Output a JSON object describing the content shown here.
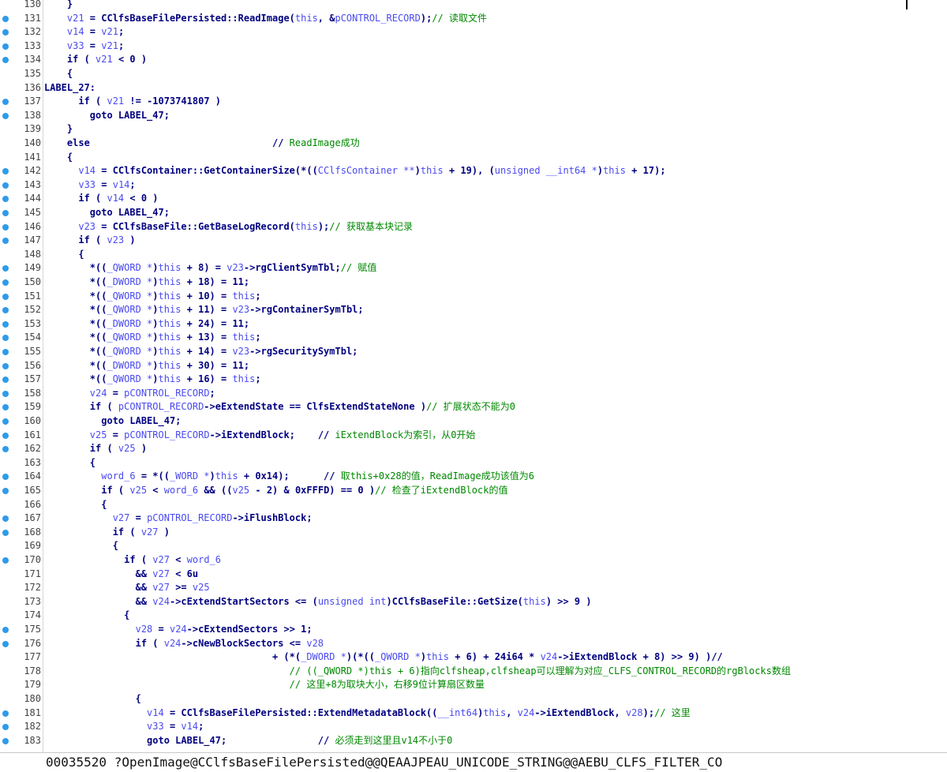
{
  "editor": {
    "lines": [
      {
        "n": "130",
        "bp": false,
        "s": [
          [
            "n",
            "    }"
          ]
        ]
      },
      {
        "n": "131",
        "bp": true,
        "s": [
          [
            "v",
            "    v21"
          ],
          [
            "n",
            " = CClfsBaseFilePersisted::ReadImage("
          ],
          [
            "v",
            "this"
          ],
          [
            "n",
            ", &"
          ],
          [
            "v",
            "pCONTROL_RECORD"
          ],
          [
            "n",
            ");"
          ],
          [
            "c",
            "// 读取文件"
          ]
        ]
      },
      {
        "n": "132",
        "bp": true,
        "s": [
          [
            "v",
            "    v14"
          ],
          [
            "n",
            " = "
          ],
          [
            "v",
            "v21"
          ],
          [
            "n",
            ";"
          ]
        ]
      },
      {
        "n": "133",
        "bp": true,
        "s": [
          [
            "v",
            "    v33"
          ],
          [
            "n",
            " = "
          ],
          [
            "v",
            "v21"
          ],
          [
            "n",
            ";"
          ]
        ]
      },
      {
        "n": "134",
        "bp": true,
        "s": [
          [
            "n",
            "    if ( "
          ],
          [
            "v",
            "v21"
          ],
          [
            "n",
            " < 0 )"
          ]
        ]
      },
      {
        "n": "135",
        "bp": false,
        "s": [
          [
            "n",
            "    {"
          ]
        ]
      },
      {
        "n": "136",
        "bp": false,
        "s": [
          [
            "n",
            "LABEL_27:"
          ]
        ]
      },
      {
        "n": "137",
        "bp": true,
        "s": [
          [
            "n",
            "      if ( "
          ],
          [
            "v",
            "v21"
          ],
          [
            "n",
            " != -1073741807 )"
          ]
        ]
      },
      {
        "n": "138",
        "bp": true,
        "s": [
          [
            "n",
            "        goto LABEL_47;"
          ]
        ]
      },
      {
        "n": "139",
        "bp": false,
        "s": [
          [
            "n",
            "    }"
          ]
        ]
      },
      {
        "n": "140",
        "bp": false,
        "s": [
          [
            "n",
            "    else                                // "
          ],
          [
            "c",
            "ReadImage成功"
          ]
        ]
      },
      {
        "n": "141",
        "bp": false,
        "s": [
          [
            "n",
            "    {"
          ]
        ]
      },
      {
        "n": "142",
        "bp": true,
        "s": [
          [
            "v",
            "      v14"
          ],
          [
            "n",
            " = CClfsContainer::GetContainerSize(*(("
          ],
          [
            "v",
            "CClfsContainer **"
          ],
          [
            "n",
            ")"
          ],
          [
            "v",
            "this"
          ],
          [
            "n",
            " + 19), ("
          ],
          [
            "v",
            "unsigned __int64 *"
          ],
          [
            "n",
            ")"
          ],
          [
            "v",
            "this"
          ],
          [
            "n",
            " + 17);"
          ]
        ]
      },
      {
        "n": "143",
        "bp": true,
        "s": [
          [
            "v",
            "      v33"
          ],
          [
            "n",
            " = "
          ],
          [
            "v",
            "v14"
          ],
          [
            "n",
            ";"
          ]
        ]
      },
      {
        "n": "144",
        "bp": true,
        "s": [
          [
            "n",
            "      if ( "
          ],
          [
            "v",
            "v14"
          ],
          [
            "n",
            " < 0 )"
          ]
        ]
      },
      {
        "n": "145",
        "bp": true,
        "s": [
          [
            "n",
            "        goto LABEL_47;"
          ]
        ]
      },
      {
        "n": "146",
        "bp": true,
        "s": [
          [
            "v",
            "      v23"
          ],
          [
            "n",
            " = CClfsBaseFile::GetBaseLogRecord("
          ],
          [
            "v",
            "this"
          ],
          [
            "n",
            ");"
          ],
          [
            "c",
            "// 获取基本块记录"
          ]
        ]
      },
      {
        "n": "147",
        "bp": true,
        "s": [
          [
            "n",
            "      if ( "
          ],
          [
            "v",
            "v23"
          ],
          [
            "n",
            " )"
          ]
        ]
      },
      {
        "n": "148",
        "bp": false,
        "s": [
          [
            "n",
            "      {"
          ]
        ]
      },
      {
        "n": "149",
        "bp": true,
        "s": [
          [
            "n",
            "        *(("
          ],
          [
            "v",
            "_QWORD *"
          ],
          [
            "n",
            ")"
          ],
          [
            "v",
            "this"
          ],
          [
            "n",
            " + 8) = "
          ],
          [
            "v",
            "v23"
          ],
          [
            "n",
            "->rgClientSymTbl;"
          ],
          [
            "c",
            "// 赋值"
          ]
        ]
      },
      {
        "n": "150",
        "bp": true,
        "s": [
          [
            "n",
            "        *(("
          ],
          [
            "v",
            "_DWORD *"
          ],
          [
            "n",
            ")"
          ],
          [
            "v",
            "this"
          ],
          [
            "n",
            " + 18) = 11;"
          ]
        ]
      },
      {
        "n": "151",
        "bp": true,
        "s": [
          [
            "n",
            "        *(("
          ],
          [
            "v",
            "_QWORD *"
          ],
          [
            "n",
            ")"
          ],
          [
            "v",
            "this"
          ],
          [
            "n",
            " + 10) = "
          ],
          [
            "v",
            "this"
          ],
          [
            "n",
            ";"
          ]
        ]
      },
      {
        "n": "152",
        "bp": true,
        "s": [
          [
            "n",
            "        *(("
          ],
          [
            "v",
            "_QWORD *"
          ],
          [
            "n",
            ")"
          ],
          [
            "v",
            "this"
          ],
          [
            "n",
            " + 11) = "
          ],
          [
            "v",
            "v23"
          ],
          [
            "n",
            "->rgContainerSymTbl;"
          ]
        ]
      },
      {
        "n": "153",
        "bp": true,
        "s": [
          [
            "n",
            "        *(("
          ],
          [
            "v",
            "_DWORD *"
          ],
          [
            "n",
            ")"
          ],
          [
            "v",
            "this"
          ],
          [
            "n",
            " + 24) = 11;"
          ]
        ]
      },
      {
        "n": "154",
        "bp": true,
        "s": [
          [
            "n",
            "        *(("
          ],
          [
            "v",
            "_QWORD *"
          ],
          [
            "n",
            ")"
          ],
          [
            "v",
            "this"
          ],
          [
            "n",
            " + 13) = "
          ],
          [
            "v",
            "this"
          ],
          [
            "n",
            ";"
          ]
        ]
      },
      {
        "n": "155",
        "bp": true,
        "s": [
          [
            "n",
            "        *(("
          ],
          [
            "v",
            "_QWORD *"
          ],
          [
            "n",
            ")"
          ],
          [
            "v",
            "this"
          ],
          [
            "n",
            " + 14) = "
          ],
          [
            "v",
            "v23"
          ],
          [
            "n",
            "->rgSecuritySymTbl;"
          ]
        ]
      },
      {
        "n": "156",
        "bp": true,
        "s": [
          [
            "n",
            "        *(("
          ],
          [
            "v",
            "_DWORD *"
          ],
          [
            "n",
            ")"
          ],
          [
            "v",
            "this"
          ],
          [
            "n",
            " + 30) = 11;"
          ]
        ]
      },
      {
        "n": "157",
        "bp": true,
        "s": [
          [
            "n",
            "        *(("
          ],
          [
            "v",
            "_QWORD *"
          ],
          [
            "n",
            ")"
          ],
          [
            "v",
            "this"
          ],
          [
            "n",
            " + 16) = "
          ],
          [
            "v",
            "this"
          ],
          [
            "n",
            ";"
          ]
        ]
      },
      {
        "n": "158",
        "bp": true,
        "s": [
          [
            "v",
            "        v24"
          ],
          [
            "n",
            " = "
          ],
          [
            "v",
            "pCONTROL_RECORD"
          ],
          [
            "n",
            ";"
          ]
        ]
      },
      {
        "n": "159",
        "bp": true,
        "s": [
          [
            "n",
            "        if ( "
          ],
          [
            "v",
            "pCONTROL_RECORD"
          ],
          [
            "n",
            "->eExtendState == ClfsExtendStateNone )"
          ],
          [
            "c",
            "// 扩展状态不能为0"
          ]
        ]
      },
      {
        "n": "160",
        "bp": true,
        "s": [
          [
            "n",
            "          goto LABEL_47;"
          ]
        ]
      },
      {
        "n": "161",
        "bp": true,
        "s": [
          [
            "v",
            "        v25"
          ],
          [
            "n",
            " = "
          ],
          [
            "v",
            "pCONTROL_RECORD"
          ],
          [
            "n",
            "->iExtendBlock;    // "
          ],
          [
            "c",
            "iExtendBlock为索引，从0开始"
          ]
        ]
      },
      {
        "n": "162",
        "bp": true,
        "s": [
          [
            "n",
            "        if ( "
          ],
          [
            "v",
            "v25"
          ],
          [
            "n",
            " )"
          ]
        ]
      },
      {
        "n": "163",
        "bp": false,
        "s": [
          [
            "n",
            "        {"
          ]
        ]
      },
      {
        "n": "164",
        "bp": true,
        "s": [
          [
            "v",
            "          word_6"
          ],
          [
            "n",
            " = *(("
          ],
          [
            "v",
            "_WORD *"
          ],
          [
            "n",
            ")"
          ],
          [
            "v",
            "this"
          ],
          [
            "n",
            " + 0x14);      // "
          ],
          [
            "c",
            "取this+0x28的值，ReadImage成功该值为6"
          ]
        ]
      },
      {
        "n": "165",
        "bp": true,
        "s": [
          [
            "n",
            "          if ( "
          ],
          [
            "v",
            "v25"
          ],
          [
            "n",
            " < "
          ],
          [
            "v",
            "word_6"
          ],
          [
            "n",
            " && (("
          ],
          [
            "v",
            "v25"
          ],
          [
            "n",
            " - 2) & 0xFFFD) == 0 )"
          ],
          [
            "c",
            "// 检查了iExtendBlock的值"
          ]
        ]
      },
      {
        "n": "166",
        "bp": false,
        "s": [
          [
            "n",
            "          {"
          ]
        ]
      },
      {
        "n": "167",
        "bp": true,
        "s": [
          [
            "v",
            "            v27"
          ],
          [
            "n",
            " = "
          ],
          [
            "v",
            "pCONTROL_RECORD"
          ],
          [
            "n",
            "->iFlushBlock;"
          ]
        ]
      },
      {
        "n": "168",
        "bp": true,
        "s": [
          [
            "n",
            "            if ( "
          ],
          [
            "v",
            "v27"
          ],
          [
            "n",
            " )"
          ]
        ]
      },
      {
        "n": "169",
        "bp": false,
        "s": [
          [
            "n",
            "            {"
          ]
        ]
      },
      {
        "n": "170",
        "bp": true,
        "s": [
          [
            "n",
            "              if ( "
          ],
          [
            "v",
            "v27"
          ],
          [
            "n",
            " < "
          ],
          [
            "v",
            "word_6"
          ]
        ]
      },
      {
        "n": "171",
        "bp": false,
        "s": [
          [
            "n",
            "                && "
          ],
          [
            "v",
            "v27"
          ],
          [
            "n",
            " < 6u"
          ]
        ]
      },
      {
        "n": "172",
        "bp": false,
        "s": [
          [
            "n",
            "                && "
          ],
          [
            "v",
            "v27"
          ],
          [
            "n",
            " >= "
          ],
          [
            "v",
            "v25"
          ]
        ]
      },
      {
        "n": "173",
        "bp": false,
        "s": [
          [
            "n",
            "                && "
          ],
          [
            "v",
            "v24"
          ],
          [
            "n",
            "->cExtendStartSectors <= ("
          ],
          [
            "v",
            "unsigned int"
          ],
          [
            "n",
            ")CClfsBaseFile::GetSize("
          ],
          [
            "v",
            "this"
          ],
          [
            "n",
            ") >> 9 )"
          ]
        ]
      },
      {
        "n": "174",
        "bp": false,
        "s": [
          [
            "n",
            "              {"
          ]
        ]
      },
      {
        "n": "175",
        "bp": true,
        "s": [
          [
            "v",
            "                v28"
          ],
          [
            "n",
            " = "
          ],
          [
            "v",
            "v24"
          ],
          [
            "n",
            "->cExtendSectors >> 1;"
          ]
        ]
      },
      {
        "n": "176",
        "bp": true,
        "s": [
          [
            "n",
            "                if ( "
          ],
          [
            "v",
            "v24"
          ],
          [
            "n",
            "->cNewBlockSectors <= "
          ],
          [
            "v",
            "v28"
          ]
        ]
      },
      {
        "n": "177",
        "bp": false,
        "s": [
          [
            "n",
            "                                        + (*("
          ],
          [
            "v",
            "_DWORD *"
          ],
          [
            "n",
            ")(*(("
          ],
          [
            "v",
            "_QWORD *"
          ],
          [
            "n",
            ")"
          ],
          [
            "v",
            "this"
          ],
          [
            "n",
            " + 6) + 24i64 * "
          ],
          [
            "v",
            "v24"
          ],
          [
            "n",
            "->iExtendBlock + 8) >> 9) )//"
          ]
        ]
      },
      {
        "n": "178",
        "bp": false,
        "s": [
          [
            "n",
            "                                           "
          ],
          [
            "c",
            "// ((_QWORD *)this + 6)指向clfsheap,clfsheap可以理解为对应_CLFS_CONTROL_RECORD的rgBlocks数组"
          ]
        ]
      },
      {
        "n": "179",
        "bp": false,
        "s": [
          [
            "n",
            "                                           "
          ],
          [
            "c",
            "// 这里+8为取块大小，右移9位计算扇区数量"
          ]
        ]
      },
      {
        "n": "180",
        "bp": false,
        "s": [
          [
            "n",
            "                {"
          ]
        ]
      },
      {
        "n": "181",
        "bp": true,
        "s": [
          [
            "v",
            "                  v14"
          ],
          [
            "n",
            " = CClfsBaseFilePersisted::ExtendMetadataBlock(("
          ],
          [
            "v",
            "__int64"
          ],
          [
            "n",
            ")"
          ],
          [
            "v",
            "this"
          ],
          [
            "n",
            ", "
          ],
          [
            "v",
            "v24"
          ],
          [
            "n",
            "->iExtendBlock, "
          ],
          [
            "v",
            "v28"
          ],
          [
            "n",
            ");"
          ],
          [
            "c",
            "// 这里"
          ]
        ]
      },
      {
        "n": "182",
        "bp": true,
        "s": [
          [
            "v",
            "                  v33"
          ],
          [
            "n",
            " = "
          ],
          [
            "v",
            "v14"
          ],
          [
            "n",
            ";"
          ]
        ]
      },
      {
        "n": "183",
        "bp": true,
        "s": [
          [
            "n",
            "                  goto LABEL_47;                // "
          ],
          [
            "c",
            "必须走到这里且v14不小于0"
          ]
        ]
      }
    ]
  },
  "status_bar": {
    "text": "00035520 ?OpenImage@CClfsBaseFilePersisted@@QEAAJPEAU_UNICODE_STRING@@AEBU_CLFS_FILTER_CO"
  },
  "colors": {
    "breakpoint": "#2e9bea",
    "keyword": "#000080",
    "variable": "#4a4af0",
    "comment": "#008800"
  }
}
